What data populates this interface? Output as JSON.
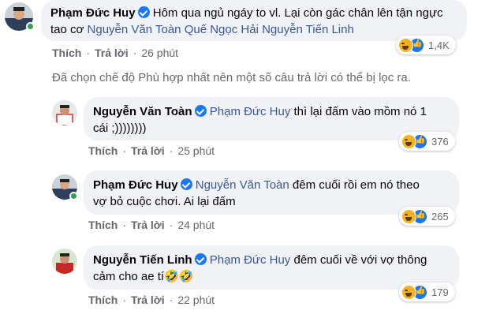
{
  "comments": [
    {
      "author": "Phạm Đức Huy",
      "text": "Hôm qua ngủ ngáy to vl. Lại còn gác chân lên tận ngực tao cơ",
      "mentions": [
        "Nguyễn Văn Toàn",
        "Quế Ngọc Hải",
        "Nguyễn Tiến Linh"
      ],
      "like_label": "Thích",
      "reply_label": "Trả lời",
      "time": "26 phút",
      "reaction_count": "1,4K",
      "reactions": [
        "haha-icon",
        "like-icon"
      ]
    },
    {
      "author": "Nguyễn Văn Toàn",
      "mentions": [
        "Phạm Đức Huy"
      ],
      "text_part1": "thì lại đấm vào mồm nó 1",
      "text_part2": "cái ;))))))))",
      "like_label": "Thích",
      "reply_label": "Trả lời",
      "time": "25 phút",
      "reaction_count": "376"
    },
    {
      "author": "Phạm Đức Huy",
      "mentions": [
        "Nguyễn Văn Toàn"
      ],
      "text_part1": "đêm cuối rồi em nó theo",
      "text_part2": "vợ bỏ cuộc chơi. Ai lại đấm",
      "like_label": "Thích",
      "reply_label": "Trả lời",
      "time": "24 phút",
      "reaction_count": "265"
    },
    {
      "author": "Nguyễn Tiến Linh",
      "mentions": [
        "Phạm Đức Huy"
      ],
      "text_part1": "đêm cuối về với vợ thông",
      "text_part2": "cảm cho ae tí",
      "emoji": "🤣🤣",
      "like_label": "Thích",
      "reply_label": "Trả lời",
      "time": "22 phút",
      "reaction_count": "179"
    }
  ],
  "filter_note": "Đã chọn chế độ Phù hợp nhất nên một số câu trả lời có thể bị lọc ra.",
  "colors": {
    "mention": "#385898",
    "bubble": "#f0f2f5",
    "online": "#31a24c",
    "verified": "#1877f2",
    "muted": "#65676b"
  }
}
